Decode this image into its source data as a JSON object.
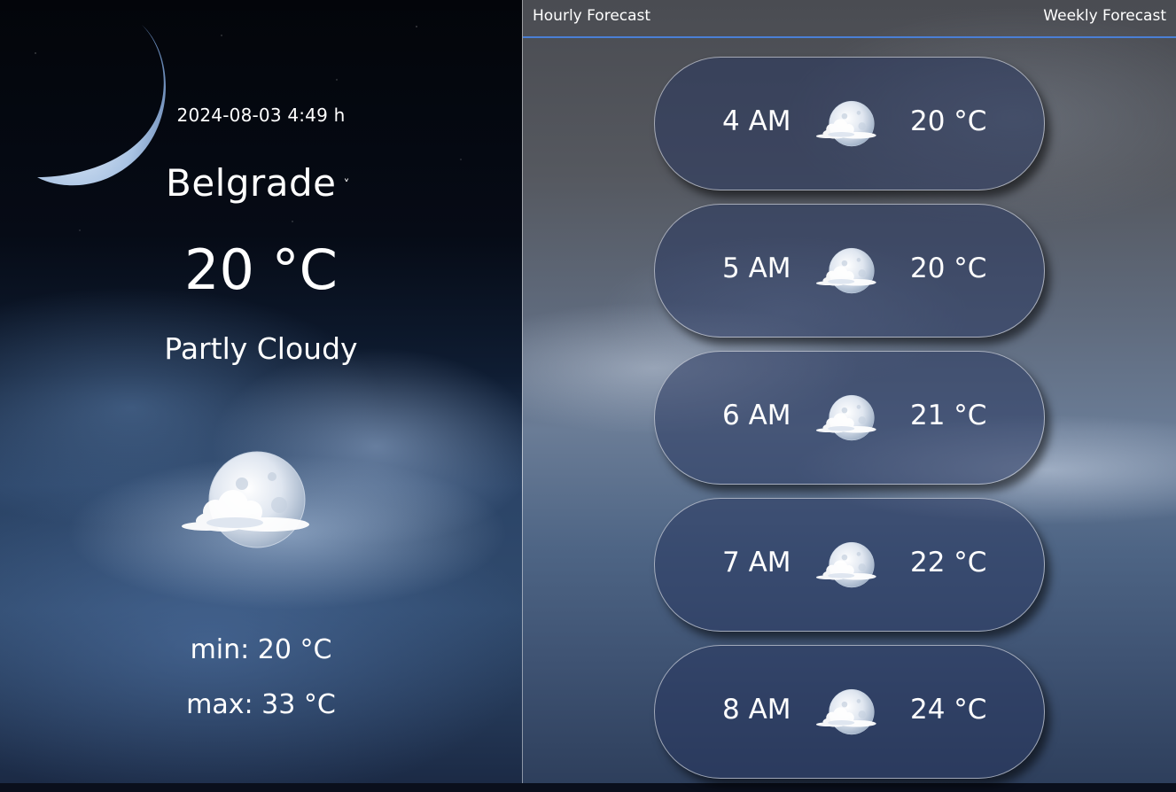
{
  "location": {
    "datetime": "2024-08-03 4:49 h",
    "city": "Belgrade",
    "city_chevron": "˅"
  },
  "current": {
    "temperature": "20 °C",
    "condition": "Partly Cloudy",
    "icon": "moon-cloud-icon",
    "min": "min: 20 °C",
    "max": "max: 33 °C"
  },
  "tabs": {
    "hourly": "Hourly Forecast",
    "weekly": "Weekly Forecast"
  },
  "hourly": [
    {
      "time": "4 AM",
      "temp": "20 °C",
      "icon": "moon-cloud-icon"
    },
    {
      "time": "5 AM",
      "temp": "20 °C",
      "icon": "moon-cloud-icon"
    },
    {
      "time": "6 AM",
      "temp": "21 °C",
      "icon": "moon-cloud-icon"
    },
    {
      "time": "7 AM",
      "temp": "22 °C",
      "icon": "moon-cloud-icon"
    },
    {
      "time": "8 AM",
      "temp": "24 °C",
      "icon": "moon-cloud-icon"
    }
  ],
  "colors": {
    "tab_underline": "#4a7fd6",
    "card_bg": "#28375f",
    "text": "#ffffff"
  }
}
